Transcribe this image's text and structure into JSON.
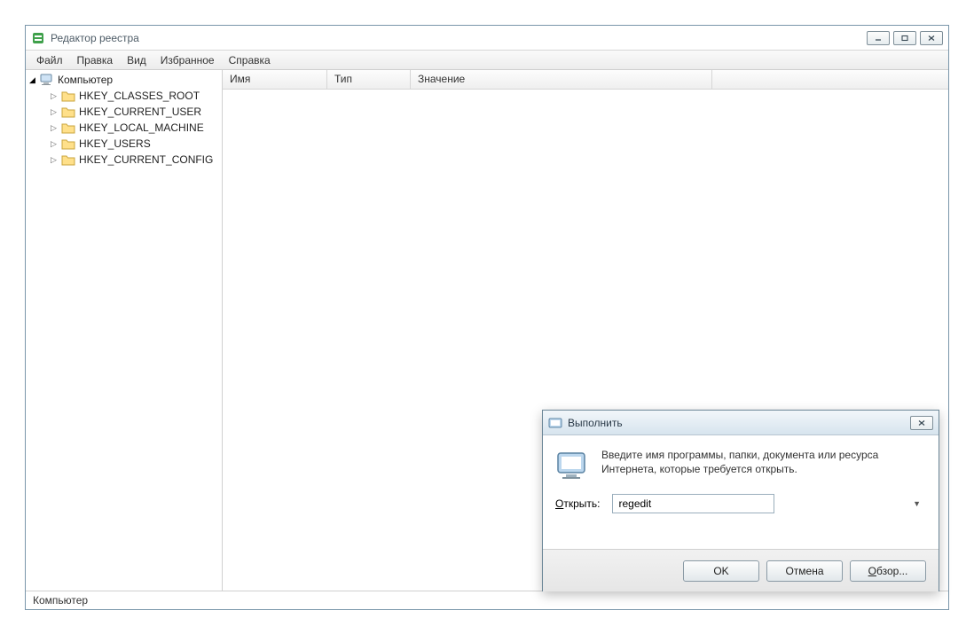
{
  "window": {
    "title": "Редактор реестра"
  },
  "menu": {
    "file": "Файл",
    "edit": "Правка",
    "view": "Вид",
    "favorites": "Избранное",
    "help": "Справка"
  },
  "tree": {
    "root": "Компьютер",
    "keys": [
      "HKEY_CLASSES_ROOT",
      "HKEY_CURRENT_USER",
      "HKEY_LOCAL_MACHINE",
      "HKEY_USERS",
      "HKEY_CURRENT_CONFIG"
    ]
  },
  "columns": {
    "name": "Имя",
    "type": "Тип",
    "value": "Значение"
  },
  "statusbar": "Компьютер",
  "run_dialog": {
    "title": "Выполнить",
    "description": "Введите имя программы, папки, документа или ресурса Интернета, которые требуется открыть.",
    "open_label": "Открыть:",
    "input_value": "regedit",
    "ok": "OK",
    "cancel": "Отмена",
    "browse": "Обзор..."
  }
}
